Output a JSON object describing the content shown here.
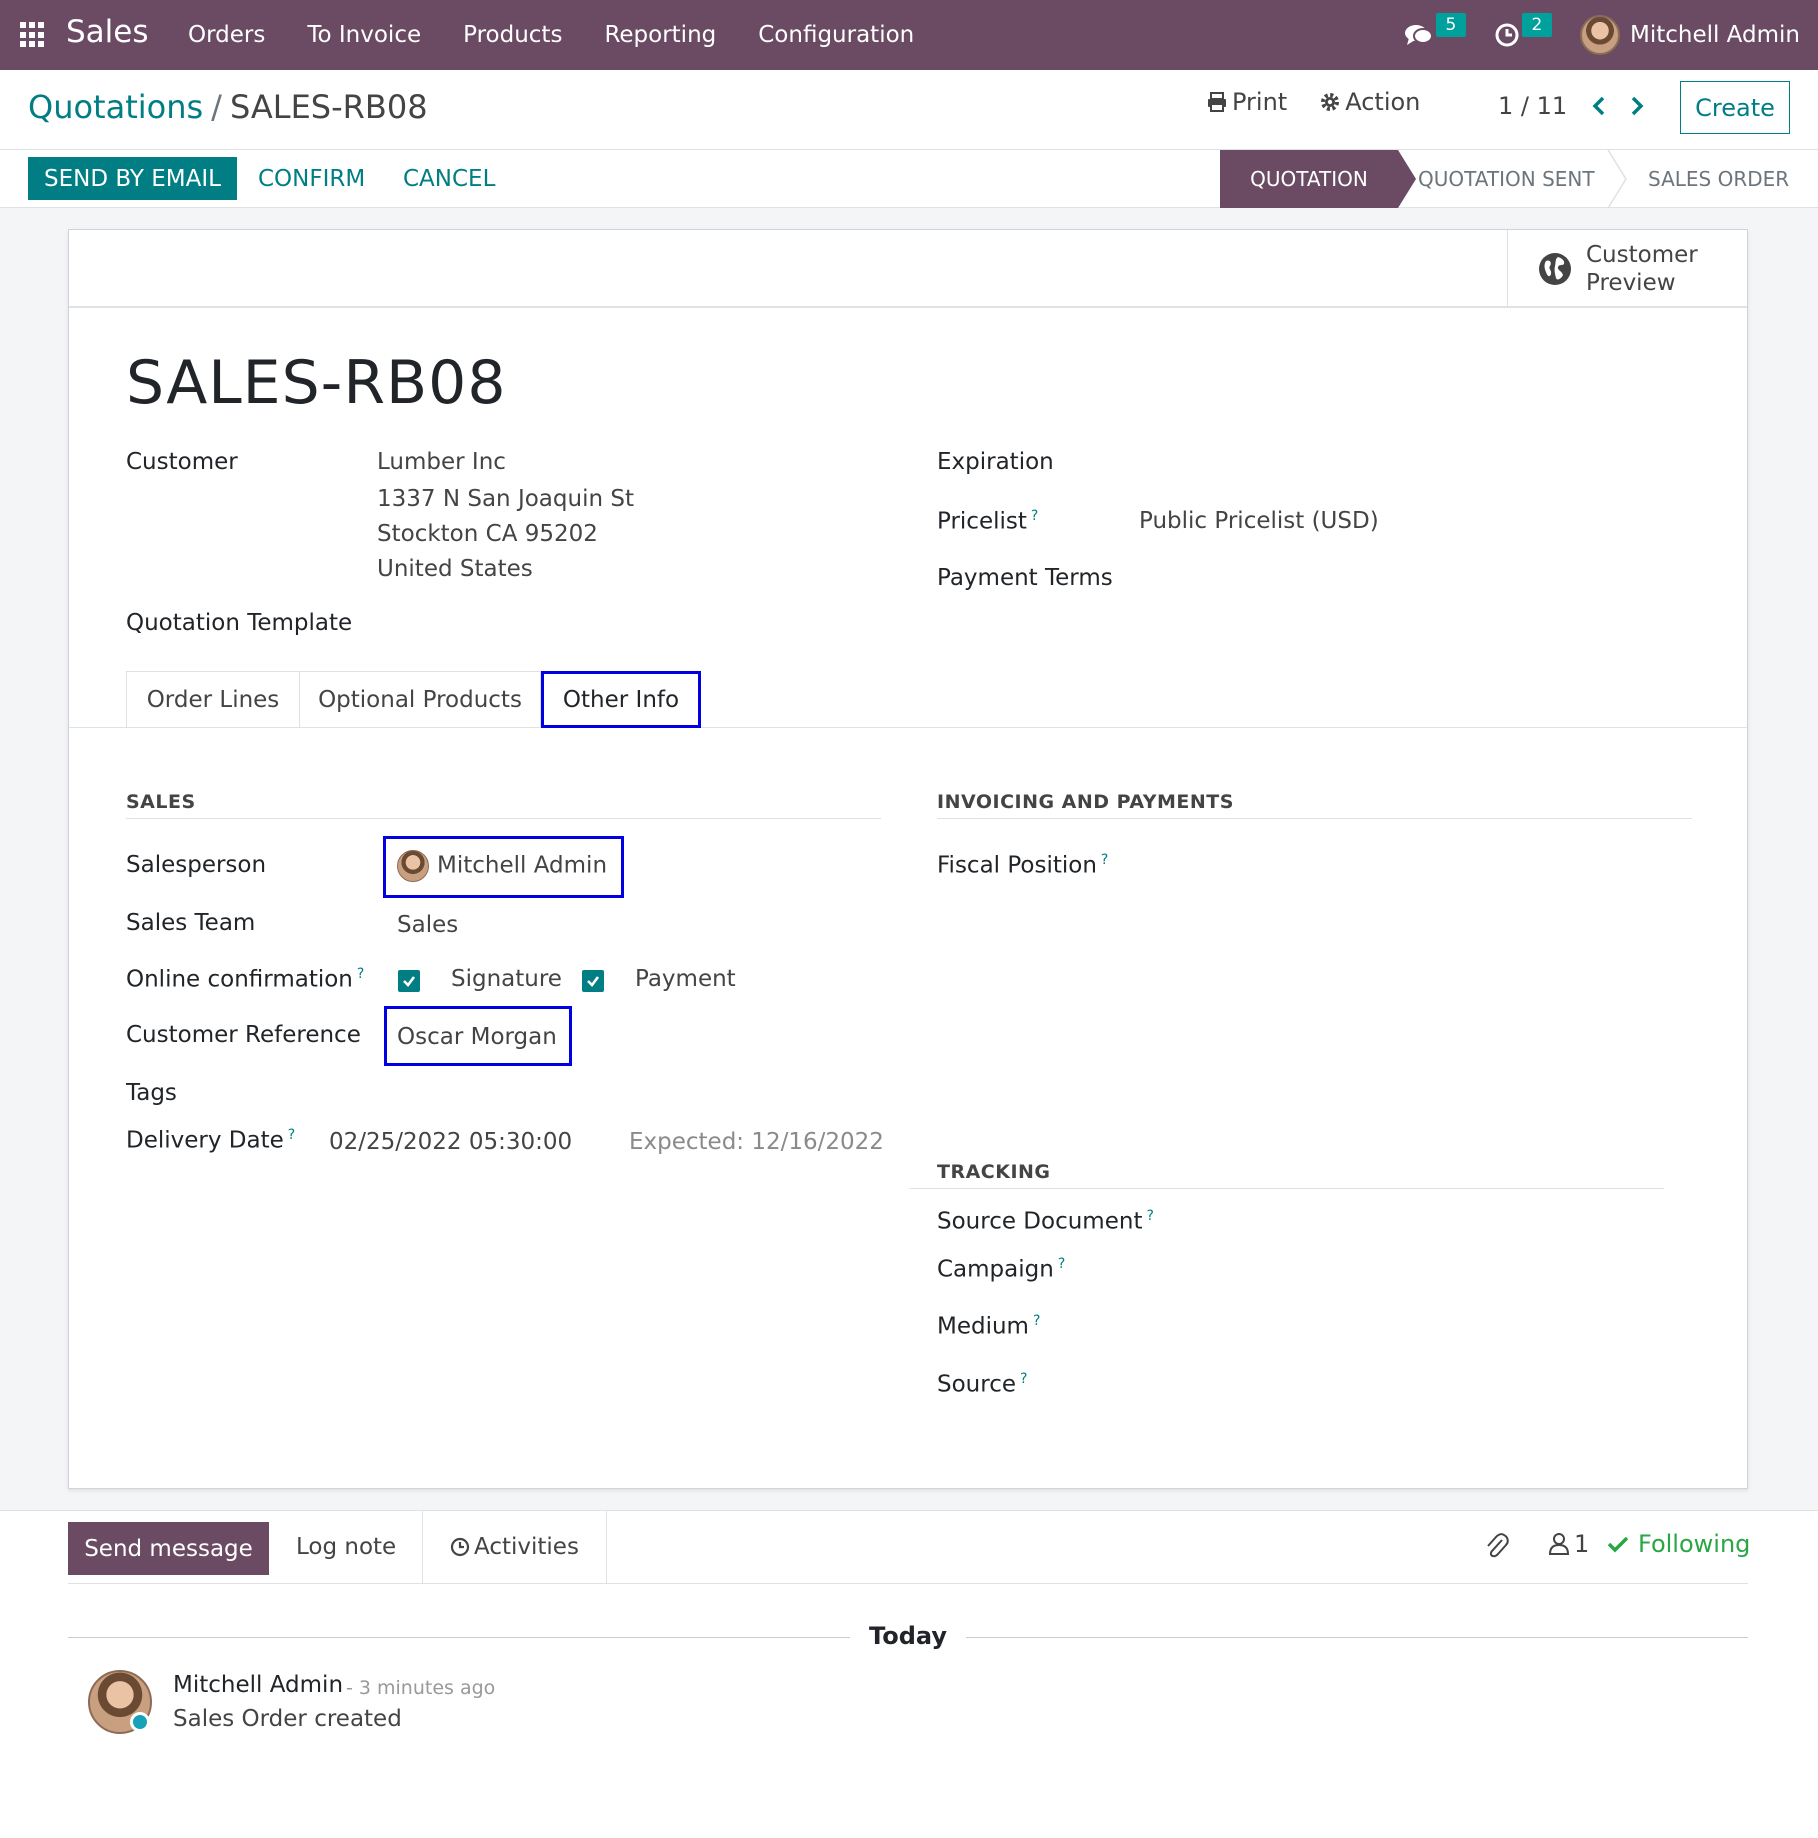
{
  "navbar": {
    "app_name": "Sales",
    "menu": [
      "Orders",
      "To Invoice",
      "Products",
      "Reporting",
      "Configuration"
    ],
    "messages_count": "5",
    "activities_count": "2",
    "user_name": "Mitchell Admin",
    "bg_color": "#6a4b63"
  },
  "control_panel": {
    "breadcrumb_parent": "Quotations",
    "breadcrumb_separator": "/",
    "breadcrumb_current": "SALES-RB08",
    "print_label": "Print",
    "action_label": "Action",
    "pager": "1 / 11",
    "create_label": "Create"
  },
  "statusbar": {
    "send_email_label": "SEND BY EMAIL",
    "confirm_label": "CONFIRM",
    "cancel_label": "CANCEL",
    "stages": [
      "QUOTATION",
      "QUOTATION SENT",
      "SALES ORDER"
    ],
    "active_stage": "QUOTATION"
  },
  "sheet": {
    "customer_preview_line1": "Customer",
    "customer_preview_line2": "Preview",
    "title": "SALES-RB08",
    "customer_label": "Customer",
    "customer_name": "Lumber Inc",
    "customer_address": [
      "1337 N San Joaquin St",
      "Stockton CA 95202",
      "United States"
    ],
    "quotation_template_label": "Quotation Template",
    "expiration_label": "Expiration",
    "pricelist_label": "Pricelist",
    "pricelist_value": "Public Pricelist (USD)",
    "payment_terms_label": "Payment Terms",
    "help_mark": "?"
  },
  "tabs": [
    "Order Lines",
    "Optional Products",
    "Other Info"
  ],
  "active_tab": "Other Info",
  "other_info": {
    "sales_group_title": "SALES",
    "salesperson_label": "Salesperson",
    "salesperson_value": "Mitchell Admin",
    "sales_team_label": "Sales Team",
    "sales_team_value": "Sales",
    "online_confirmation_label": "Online confirmation",
    "signature_label": "Signature",
    "signature_checked": true,
    "payment_label": "Payment",
    "payment_checked": true,
    "customer_reference_label": "Customer Reference",
    "customer_reference_value": "Oscar Morgan",
    "tags_label": "Tags",
    "delivery_date_label": "Delivery Date",
    "delivery_date_value": "02/25/2022 05:30:00",
    "expected_date": "Expected: 12/16/2022",
    "invoicing_group_title": "INVOICING AND PAYMENTS",
    "fiscal_position_label": "Fiscal Position",
    "tracking_group_title": "TRACKING",
    "source_document_label": "Source Document",
    "campaign_label": "Campaign",
    "medium_label": "Medium",
    "source_label": "Source"
  },
  "chatter": {
    "send_message_label": "Send message",
    "log_note_label": "Log note",
    "activities_label": "Activities",
    "followers_count": "1",
    "following_label": "Following",
    "date_separator": "Today",
    "message_author": "Mitchell Admin",
    "message_time": "- 3 minutes ago",
    "message_body": "Sales Order created"
  },
  "colors": {
    "primary": "#017e84",
    "brand": "#6a4b63",
    "highlight": "#0000e0",
    "following": "#28a745"
  }
}
